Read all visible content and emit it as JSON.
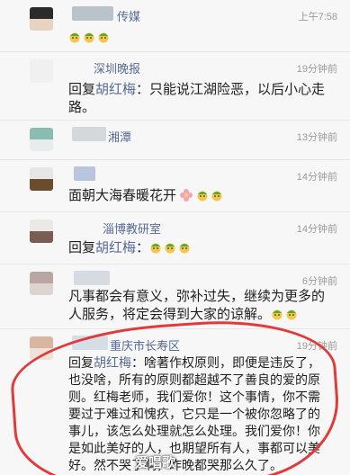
{
  "comments": [
    {
      "name": "传媒",
      "time": "上午7:58",
      "text": "",
      "reply_to": "",
      "emoji_count": 3,
      "name_color": "#576b95",
      "avatar_colors": [
        "#2b2b2b",
        "#e8d2c0"
      ]
    },
    {
      "name": "深圳晚报",
      "time": "19分钟前",
      "text": "：只能说江湖险恶，以后小心走路。",
      "reply_to": "胡红梅",
      "emoji_count": 0,
      "avatar_colors": [
        "#f0f0f0",
        "#f0f0f0"
      ]
    },
    {
      "name": "湘潭",
      "time": "13分钟前",
      "text": "",
      "reply_to": "",
      "emoji_count": 0,
      "avatar_colors": [
        "#8bbcb2",
        "#e9ecec"
      ]
    },
    {
      "name": "",
      "time": "14分钟前",
      "text": "面朝大海春暖花开",
      "reply_to": "",
      "emoji_count": 2,
      "avatar_colors": [
        "#e6e6e6",
        "#6b4d2e"
      ]
    },
    {
      "name": "淄博教研室",
      "time": "14分钟前",
      "text": "：",
      "reply_to": "胡红梅",
      "emoji_count": 3,
      "avatar_colors": [
        "#ece8e6",
        "#7a5c50"
      ]
    },
    {
      "name": "",
      "time": "6分钟前",
      "text": "凡事都会有意义，弥补过失，继续为更多的人服务，将定会得到大家的谅解。",
      "reply_to": "",
      "emoji_count": 2,
      "avatar_colors": [
        "#b9a6a2",
        "#ddd3cf"
      ]
    },
    {
      "name": "重庆市长寿区",
      "time": "19分钟前",
      "text": "：啥著作权原则，即便是违反了，也没啥，所有的原则都超越不了善良的爱的原则。红梅老师，我们爱你！这个事情，你不需要过于难过和愧疚，它只是一个被你忽略了的事儿，该怎么处理就怎么处理。我们爱你！你是如此美好的人，也期望所有人，事都可以美好。然不哭了啊，昨晚都哭那么久了。",
      "reply_to": "胡红梅",
      "emoji_count": 0,
      "avatar_colors": [
        "#d8b6a0",
        "#efe2d8"
      ]
    }
  ],
  "labels": {
    "reply_prefix": "回复",
    "watermark": "爱唱歌",
    "overlay_note": "我们爱你"
  },
  "colors": {
    "link_blue": "#576b95",
    "time_gray": "#9a9a9a",
    "highlight_red": "#e23a3a",
    "emoji_green": "#5aa832",
    "emoji_yellow": "#f2c84b"
  }
}
